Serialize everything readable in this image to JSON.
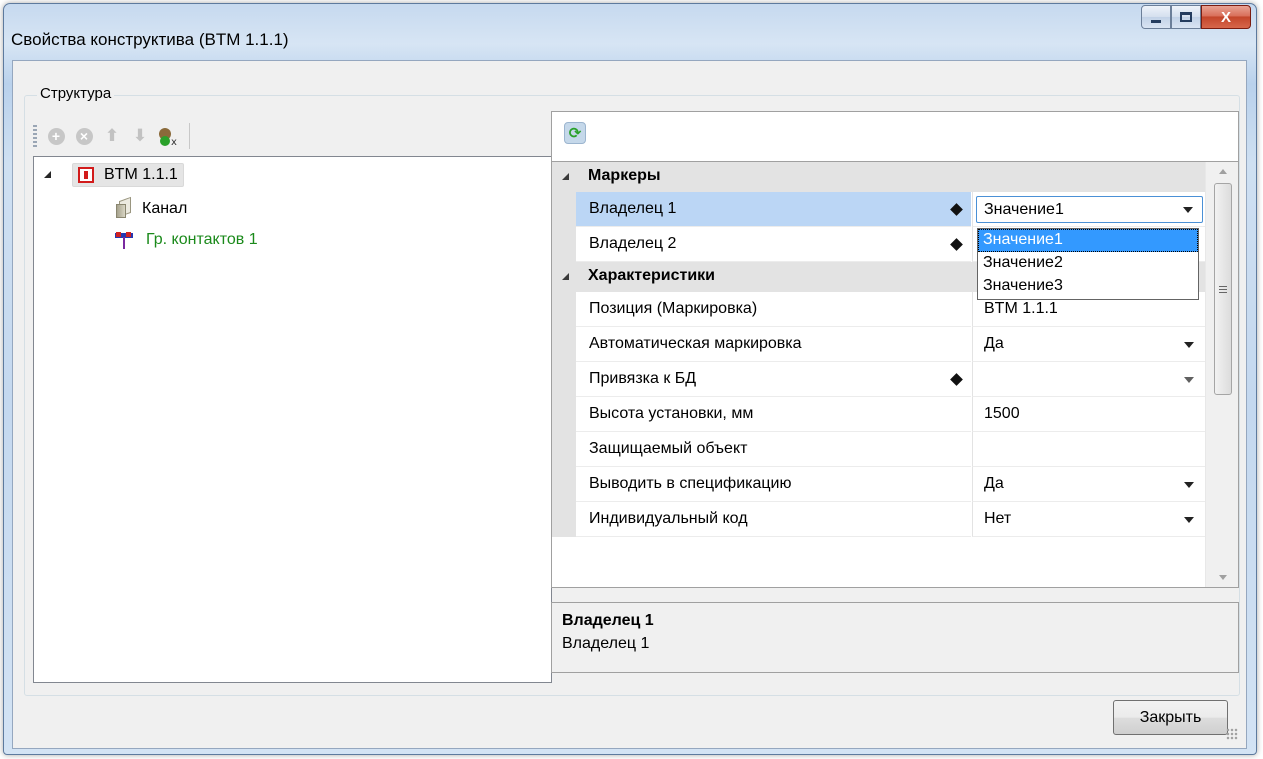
{
  "window": {
    "title": "Свойства конструктива (BTM 1.1.1)",
    "min_symbol": "",
    "max_symbol": "",
    "close_symbol": "X"
  },
  "structure": {
    "group_label": "Структура",
    "toolbar": {
      "icons": [
        "add-icon",
        "remove-icon",
        "move-up-icon",
        "move-down-icon",
        "add-element-icon"
      ]
    },
    "tree": {
      "root": {
        "label": "BTM 1.1.1",
        "icon": "device-icon"
      },
      "children": [
        {
          "label": "Канал",
          "icon": "channel-icon"
        },
        {
          "label": "Гр. контактов 1",
          "icon": "contact-group-icon",
          "color": "#1b8a1b"
        }
      ]
    }
  },
  "properties": {
    "refresh_icon": "refresh-icon",
    "categories": [
      {
        "name": "Маркеры",
        "rows": [
          {
            "name": "Владелец 1",
            "value": "Значение1",
            "has_diamond": true,
            "has_dropdown": true,
            "selected": true,
            "editing": true
          },
          {
            "name": "Владелец 2",
            "value": "",
            "has_diamond": true,
            "has_dropdown": false
          }
        ]
      },
      {
        "name": "Характеристики",
        "rows": [
          {
            "name": "Позиция (Маркировка)",
            "value": "BTM 1.1.1",
            "has_dropdown": false
          },
          {
            "name": "Автоматическая маркировка",
            "value": "Да",
            "has_dropdown": true
          },
          {
            "name": "Привязка к БД",
            "value": "",
            "has_diamond": true,
            "has_dropdown": true,
            "dropdown_gray": true
          },
          {
            "name": "Высота установки, мм",
            "value": "1500",
            "has_dropdown": false
          },
          {
            "name": "Защищаемый объект",
            "value": "",
            "has_dropdown": false
          },
          {
            "name": "Выводить в спецификацию",
            "value": "Да",
            "has_dropdown": true
          },
          {
            "name": "Индивидуальный код",
            "value": "Нет",
            "has_dropdown": true
          }
        ]
      }
    ],
    "dropdown_options": [
      "Значение1",
      "Значение2",
      "Значение3"
    ],
    "dropdown_selected": "Значение1",
    "description": {
      "title": "Владелец 1",
      "text": "Владелец 1"
    }
  },
  "footer": {
    "close_label": "Закрыть"
  }
}
